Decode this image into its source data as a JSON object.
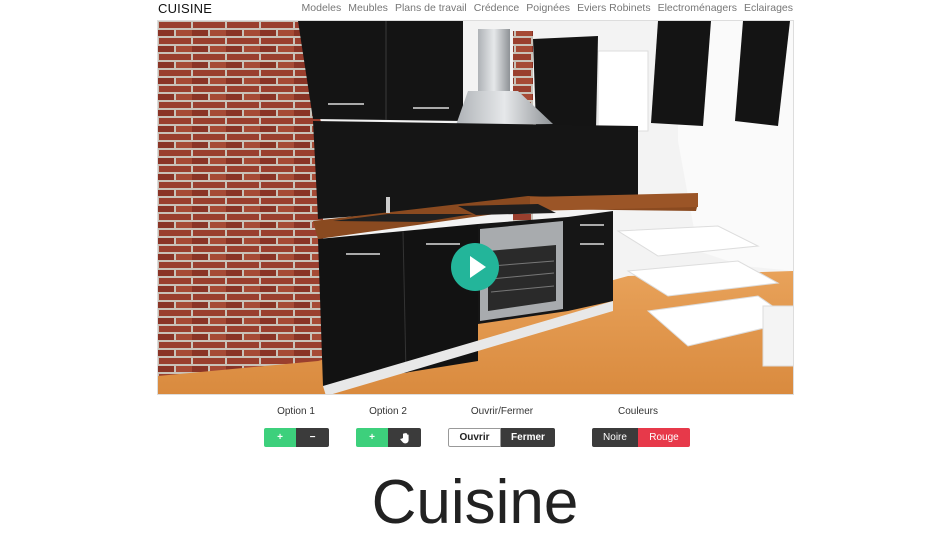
{
  "header": {
    "brand": "CUISINE",
    "nav": [
      "Modeles",
      "Meubles",
      "Plans de travail",
      "Crédence",
      "Poignées",
      "Eviers Robinets",
      "Electroménagers",
      "Eclairages"
    ]
  },
  "viewer": {
    "play_icon": "play-icon",
    "colors": {
      "play": "#23b59a",
      "cabinet": "#111111",
      "countertop": "#8a4a20",
      "floor": "#e39b52",
      "brick": "#8b3a2a"
    }
  },
  "controls": {
    "option1": {
      "label": "Option 1",
      "add": "+",
      "remove": "−"
    },
    "option2": {
      "label": "Option 2",
      "add": "+",
      "hand_icon": "hand-icon"
    },
    "doors": {
      "label": "Ouvrir/Fermer",
      "open": "Ouvrir",
      "close": "Fermer"
    },
    "colors": {
      "label": "Couleurs",
      "black": "Noire",
      "red": "Rouge",
      "black_hex": "#3b3b3b",
      "red_hex": "#e7394a"
    }
  },
  "page_title": "Cuisine"
}
